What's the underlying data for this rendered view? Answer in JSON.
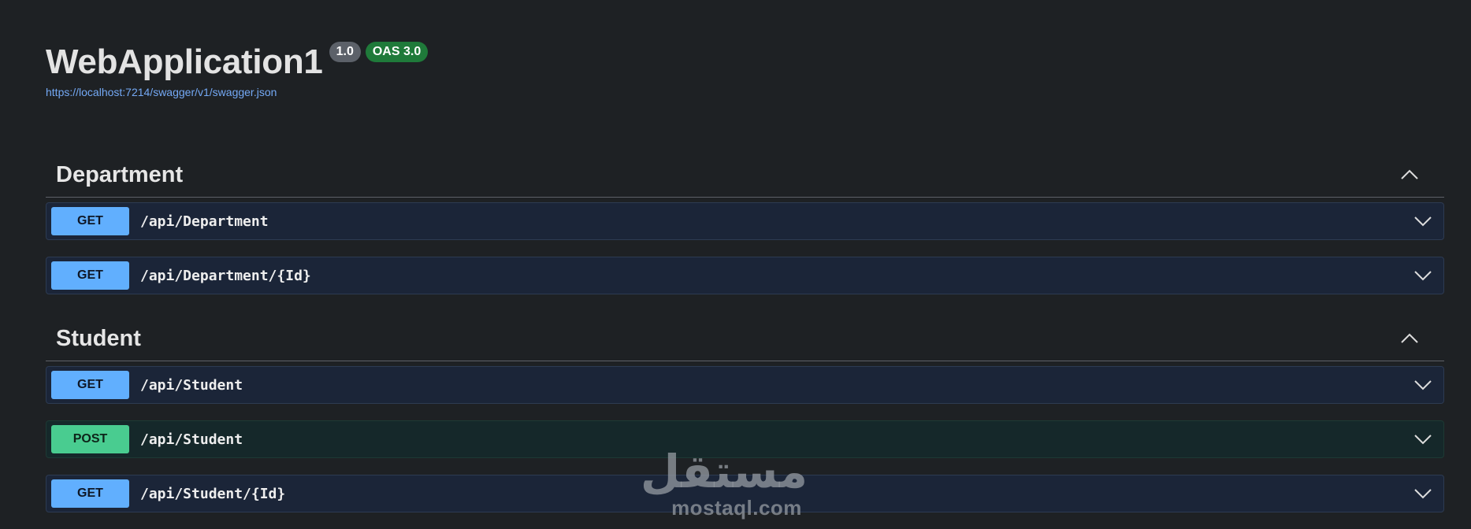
{
  "info": {
    "title": "WebApplication1",
    "version_badge": "1.0",
    "oas_badge": "OAS 3.0",
    "spec_url": "https://localhost:7214/swagger/v1/swagger.json"
  },
  "tags": [
    {
      "name": "Department",
      "expanded": true,
      "toggle_icon": "chevron-up-icon",
      "operations": [
        {
          "method": "GET",
          "path": "/api/Department",
          "color": "#61affe",
          "toggle_icon": "chevron-down-icon"
        },
        {
          "method": "GET",
          "path": "/api/Department/{Id}",
          "color": "#61affe",
          "toggle_icon": "chevron-down-icon"
        }
      ]
    },
    {
      "name": "Student",
      "expanded": true,
      "toggle_icon": "chevron-up-icon",
      "operations": [
        {
          "method": "GET",
          "path": "/api/Student",
          "color": "#61affe",
          "toggle_icon": "chevron-down-icon"
        },
        {
          "method": "POST",
          "path": "/api/Student",
          "color": "#49cc90",
          "toggle_icon": "chevron-down-icon"
        },
        {
          "method": "GET",
          "path": "/api/Student/{Id}",
          "color": "#61affe",
          "toggle_icon": "chevron-down-icon"
        }
      ]
    }
  ],
  "watermark": {
    "logo": "مستقل",
    "text": "mostaql.com"
  },
  "colors": {
    "background": "#1e2124",
    "get": "#61affe",
    "post": "#49cc90",
    "link": "#74a9f5",
    "badge_version": "#5c6169",
    "badge_oas": "#1f7a3a"
  }
}
